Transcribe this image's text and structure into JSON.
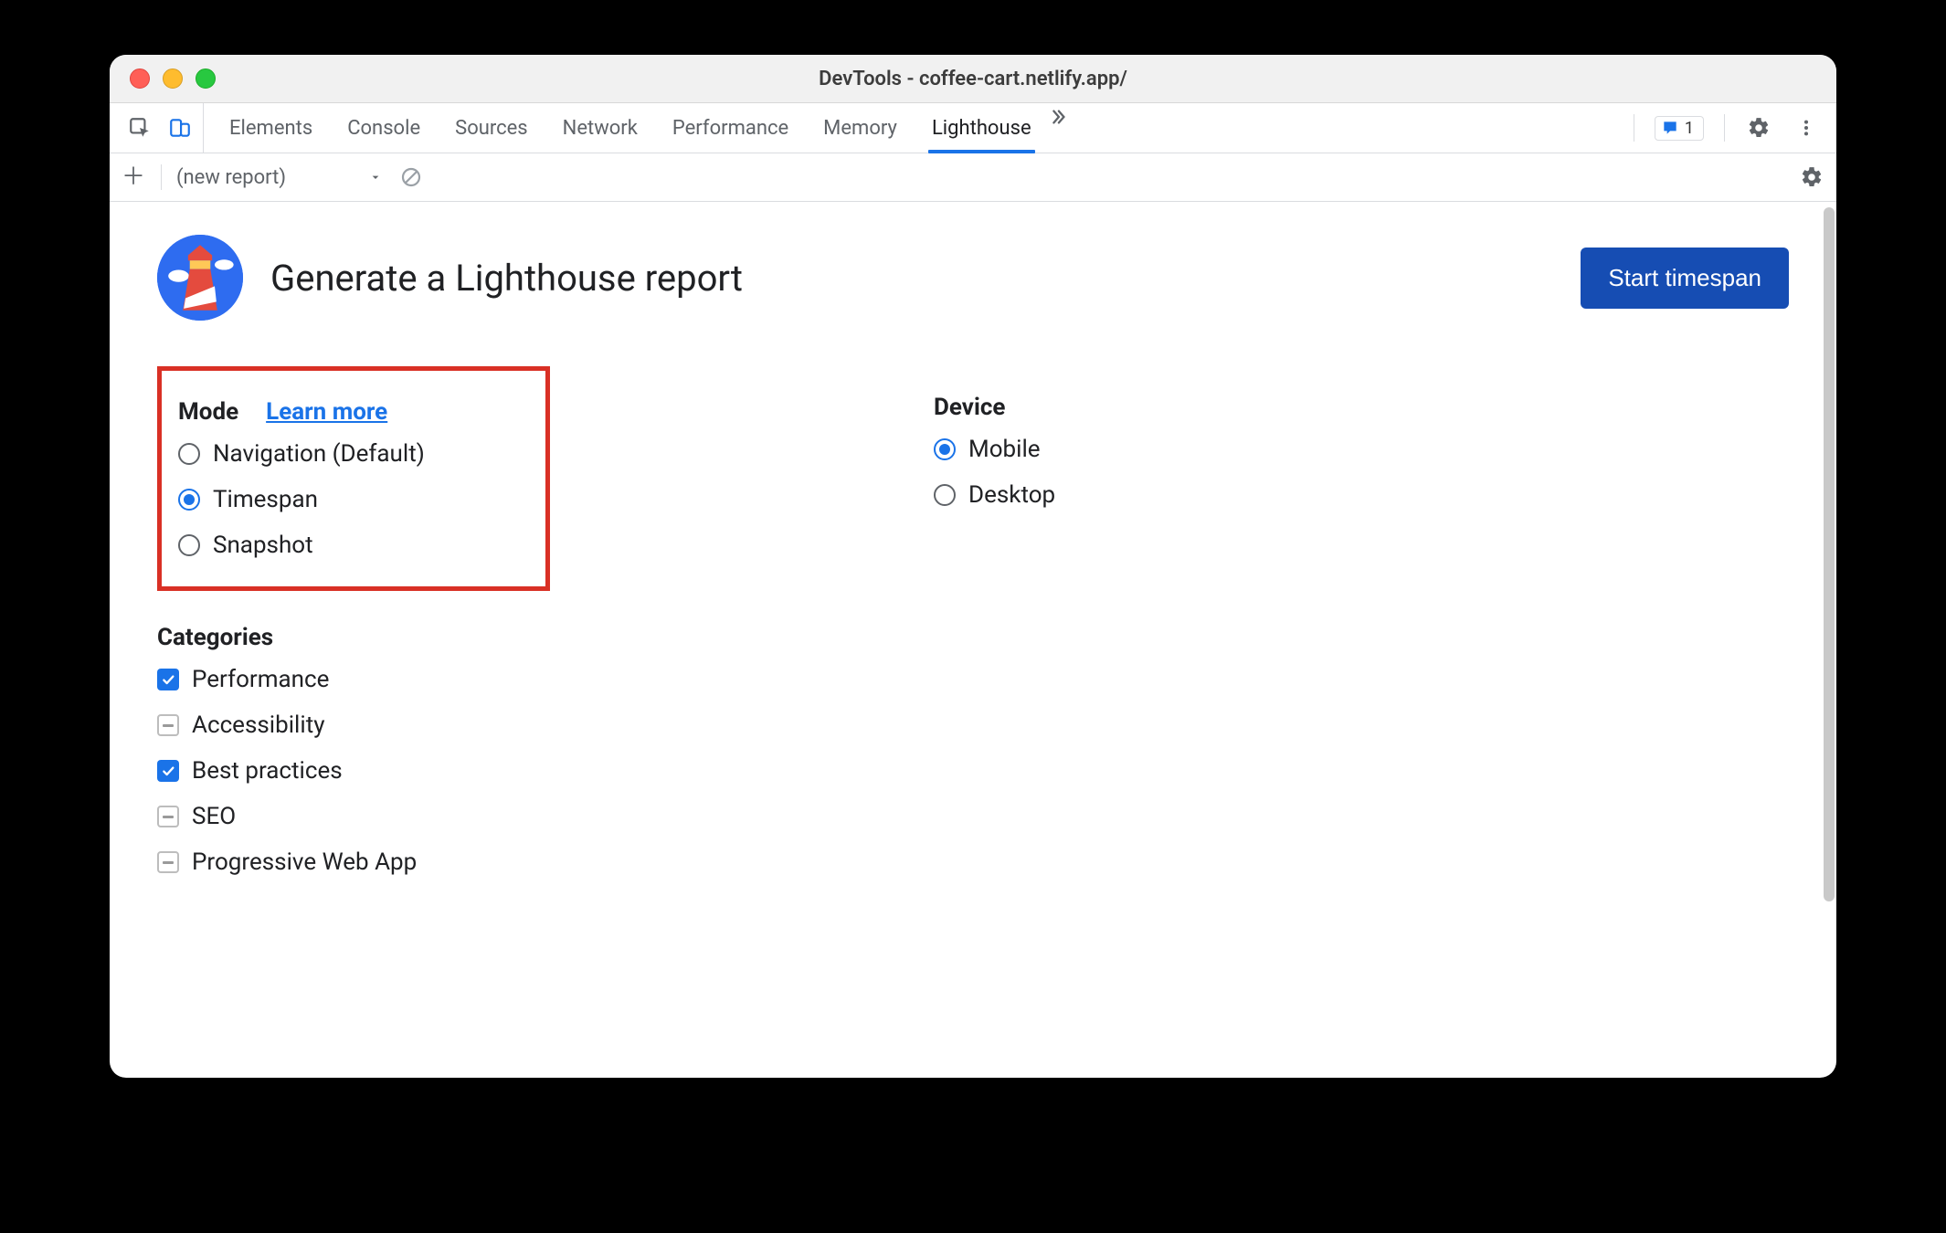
{
  "colors": {
    "accent": "#1a73e8",
    "button": "#164db3",
    "highlight": "#d93025"
  },
  "window": {
    "title": "DevTools - coffee-cart.netlify.app/"
  },
  "tabs": {
    "items": [
      "Elements",
      "Console",
      "Sources",
      "Network",
      "Performance",
      "Memory",
      "Lighthouse"
    ],
    "selected": "Lighthouse",
    "issueCount": "1"
  },
  "subbar": {
    "reportLabel": "(new report)"
  },
  "lighthouse": {
    "title": "Generate a Lighthouse report",
    "startButton": "Start timespan",
    "mode": {
      "heading": "Mode",
      "learnMore": "Learn more",
      "options": [
        {
          "label": "Navigation (Default)",
          "checked": false
        },
        {
          "label": "Timespan",
          "checked": true
        },
        {
          "label": "Snapshot",
          "checked": false
        }
      ]
    },
    "device": {
      "heading": "Device",
      "options": [
        {
          "label": "Mobile",
          "checked": true
        },
        {
          "label": "Desktop",
          "checked": false
        }
      ]
    },
    "categories": {
      "heading": "Categories",
      "options": [
        {
          "label": "Performance",
          "state": "checked"
        },
        {
          "label": "Accessibility",
          "state": "indeterminate"
        },
        {
          "label": "Best practices",
          "state": "checked"
        },
        {
          "label": "SEO",
          "state": "indeterminate"
        },
        {
          "label": "Progressive Web App",
          "state": "indeterminate"
        }
      ]
    }
  }
}
